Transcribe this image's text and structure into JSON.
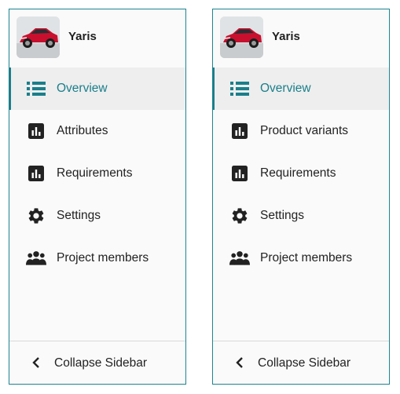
{
  "colors": {
    "accent": "#1a7f8b",
    "border": "#1d8490",
    "active_bg": "#eeeeee",
    "icon": "#222222"
  },
  "left_panel": {
    "product": {
      "name": "Yaris",
      "thumbnail_icon": "red-car-image"
    },
    "nav": [
      {
        "label": "Overview",
        "icon": "list-icon",
        "active": true
      },
      {
        "label": "Attributes",
        "icon": "bar-chart-icon",
        "active": false
      },
      {
        "label": "Requirements",
        "icon": "bar-chart-icon",
        "active": false
      },
      {
        "label": "Settings",
        "icon": "gear-icon",
        "active": false
      },
      {
        "label": "Project members",
        "icon": "people-icon",
        "active": false
      }
    ],
    "footer": {
      "label": "Collapse Sidebar",
      "icon": "chevron-left-icon"
    }
  },
  "right_panel": {
    "product": {
      "name": "Yaris",
      "thumbnail_icon": "red-car-image"
    },
    "nav": [
      {
        "label": "Overview",
        "icon": "list-icon",
        "active": true
      },
      {
        "label": "Product variants",
        "icon": "bar-chart-icon",
        "active": false
      },
      {
        "label": "Requirements",
        "icon": "bar-chart-icon",
        "active": false
      },
      {
        "label": "Settings",
        "icon": "gear-icon",
        "active": false
      },
      {
        "label": "Project members",
        "icon": "people-icon",
        "active": false
      }
    ],
    "footer": {
      "label": "Collapse Sidebar",
      "icon": "chevron-left-icon"
    }
  }
}
